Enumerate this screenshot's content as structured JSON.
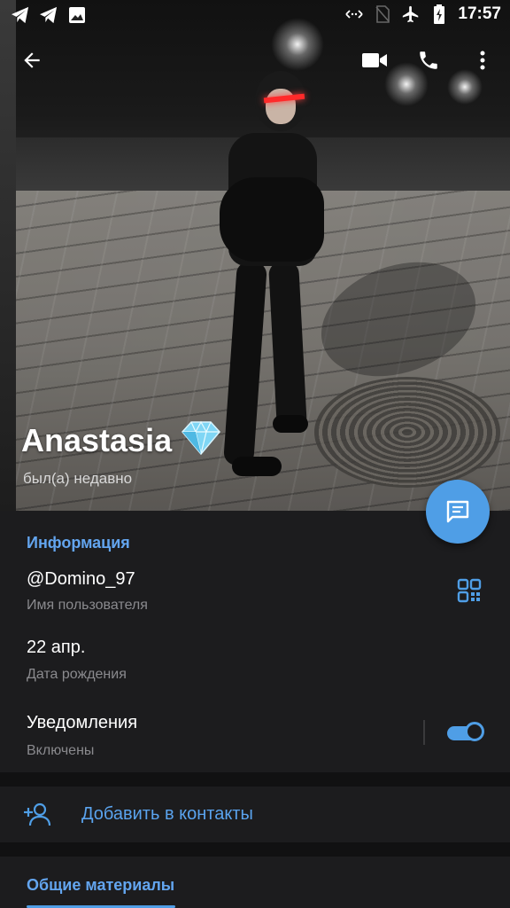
{
  "status_bar": {
    "time": "17:57",
    "left_icons": [
      "telegram-icon",
      "telegram-icon",
      "image-icon"
    ],
    "right_icons": [
      "data-arrows-icon",
      "no-sim-icon",
      "airplane-icon",
      "battery-charging-icon"
    ]
  },
  "toolbar": {
    "icons": [
      "back-arrow-icon",
      "video-call-icon",
      "phone-icon",
      "more-vert-icon"
    ]
  },
  "profile": {
    "name": "Anastasia",
    "badge_icon": "diamond-icon",
    "last_seen": "был(а) недавно"
  },
  "fab": {
    "icon": "message-icon"
  },
  "info": {
    "title": "Информация",
    "username": "@Domino_97",
    "username_label": "Имя пользователя",
    "birthday": "22 апр.",
    "birthday_label": "Дата рождения",
    "notifications": "Уведомления",
    "notifications_state": "Включены",
    "notifications_enabled": true
  },
  "actions": {
    "add_contact": "Добавить в контакты"
  },
  "shared": {
    "tab": "Общие материалы"
  },
  "colors": {
    "accent": "#4f9ee6",
    "section_title": "#63a5ef",
    "background": "#1c1c1e",
    "secondary_text": "#8a8a8e"
  }
}
